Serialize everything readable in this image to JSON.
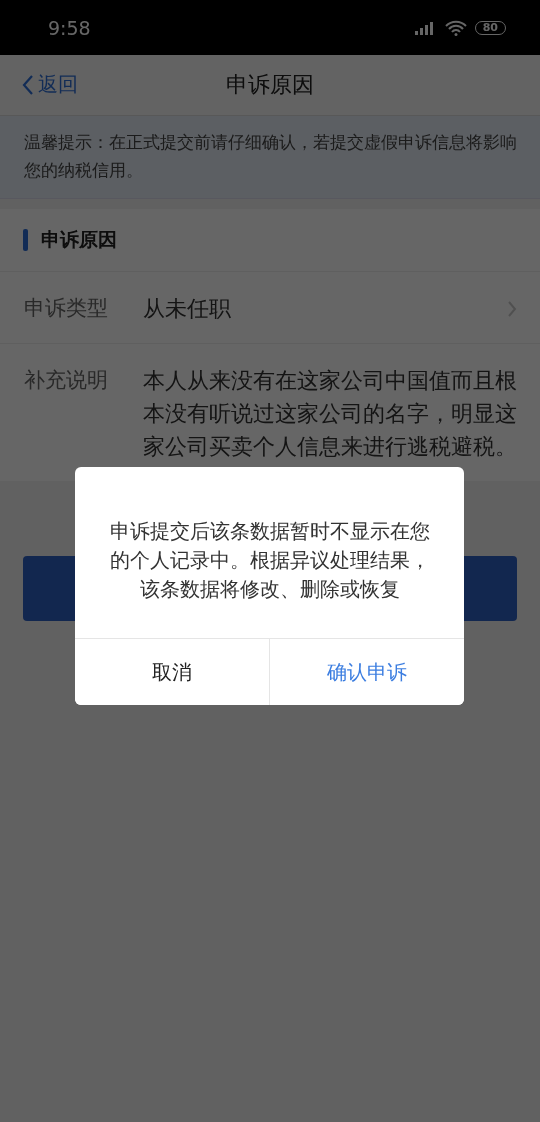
{
  "status_bar": {
    "time": "9:58",
    "battery": "80"
  },
  "nav": {
    "back": "返回",
    "title": "申诉原因"
  },
  "tip": "温馨提示：在正式提交前请仔细确认，若提交虚假申诉信息将影响您的纳税信用。",
  "section": {
    "title": "申诉原因",
    "rows": [
      {
        "kind": "select",
        "label": "申诉类型",
        "value": "从未任职"
      },
      {
        "kind": "text",
        "label": "补充说明",
        "value": "本人从来没有在这家公司中国值而且根本没有听说过这家公司的名字，明显这家公司买卖个人信息来进行逃税避税。"
      }
    ]
  },
  "dialog": {
    "message": "申诉提交后该条数据暂时不显示在您的个人记录中。根据异议处理结果，该条数据将修改、删除或恢复",
    "buttons": [
      {
        "kind": "cancel",
        "label": "取消"
      },
      {
        "kind": "confirm",
        "label": "确认申诉"
      }
    ]
  }
}
